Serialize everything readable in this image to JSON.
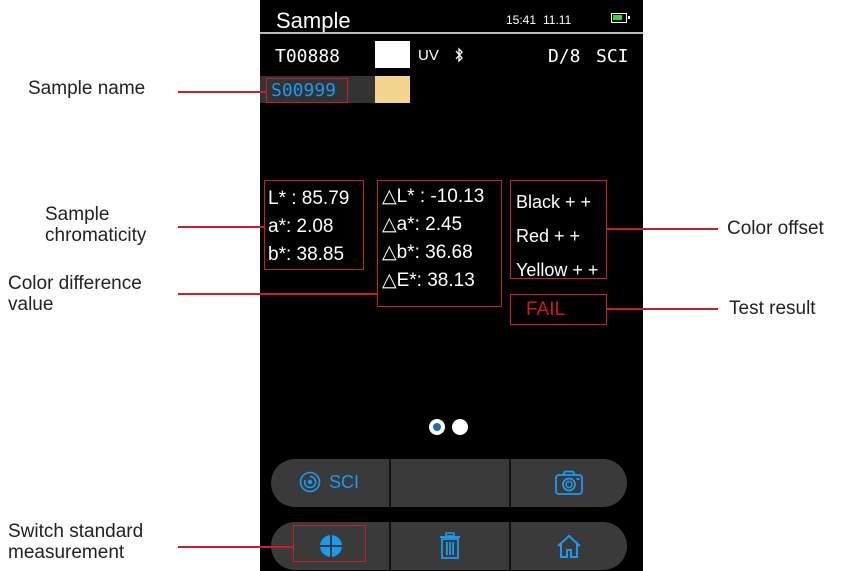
{
  "device": {
    "title": "Sample",
    "time": "15:41",
    "date": "11.11",
    "standard_id": "T00888",
    "light_source": "UV",
    "geometry": "D/8",
    "mode": "SCI",
    "sample_name": "S00999",
    "standard_swatch_color": "#ffffff",
    "sample_swatch_color": "#f3d58f",
    "chromaticity": [
      "L* : 85.79",
      "a*: 2.08",
      "b*: 38.85"
    ],
    "differences": [
      "△L* : -10.13",
      "△a*: 2.45",
      "△b*: 36.68",
      "△E*: 38.13"
    ],
    "offsets": [
      "Black + +",
      "Red + +",
      "Yellow + +"
    ],
    "result": "FAIL",
    "toolbar_top": {
      "sci_label": "SCI"
    },
    "page_indicator": {
      "pages": 2,
      "active": 0
    },
    "colors": {
      "accent": "#1b9af2",
      "fail": "#d01818",
      "annotation_red": "#c8202a"
    }
  },
  "annotations": {
    "sample_name": "Sample name",
    "sample_chromaticity": [
      "Sample",
      "chromaticity"
    ],
    "color_difference": [
      "Color difference",
      "value"
    ],
    "switch_standard": [
      "Switch standard",
      "measurement"
    ],
    "color_offset": "Color offset",
    "test_result": "Test result"
  },
  "icons": [
    "bluetooth-icon",
    "battery-icon",
    "sci-mode-icon",
    "camera-icon",
    "crosshair-icon",
    "trash-icon",
    "home-icon"
  ]
}
